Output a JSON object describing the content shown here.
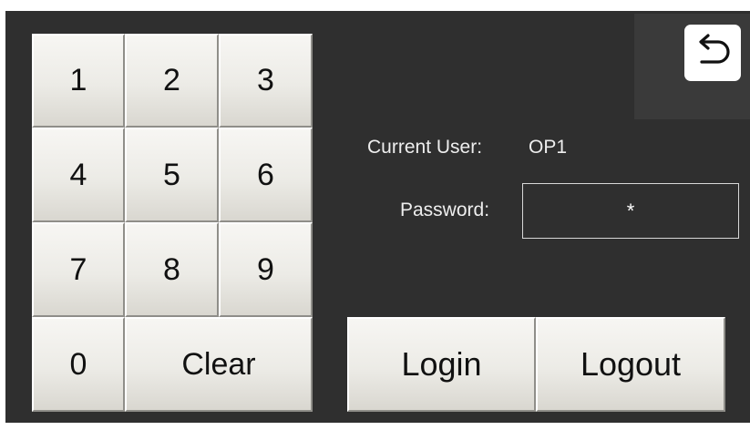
{
  "keypad": {
    "keys": [
      "1",
      "2",
      "3",
      "4",
      "5",
      "6",
      "7",
      "8",
      "9",
      "0"
    ],
    "clear_label": "Clear"
  },
  "user": {
    "current_user_label": "Current User:",
    "current_user_value": "OP1",
    "password_label": "Password:",
    "password_value": "*"
  },
  "actions": {
    "login_label": "Login",
    "logout_label": "Logout"
  },
  "icons": {
    "back": "back-arrow-icon"
  },
  "colors": {
    "background": "#2f2f2f",
    "button_face": "#ecebe6",
    "text_light": "#eeeeee"
  }
}
